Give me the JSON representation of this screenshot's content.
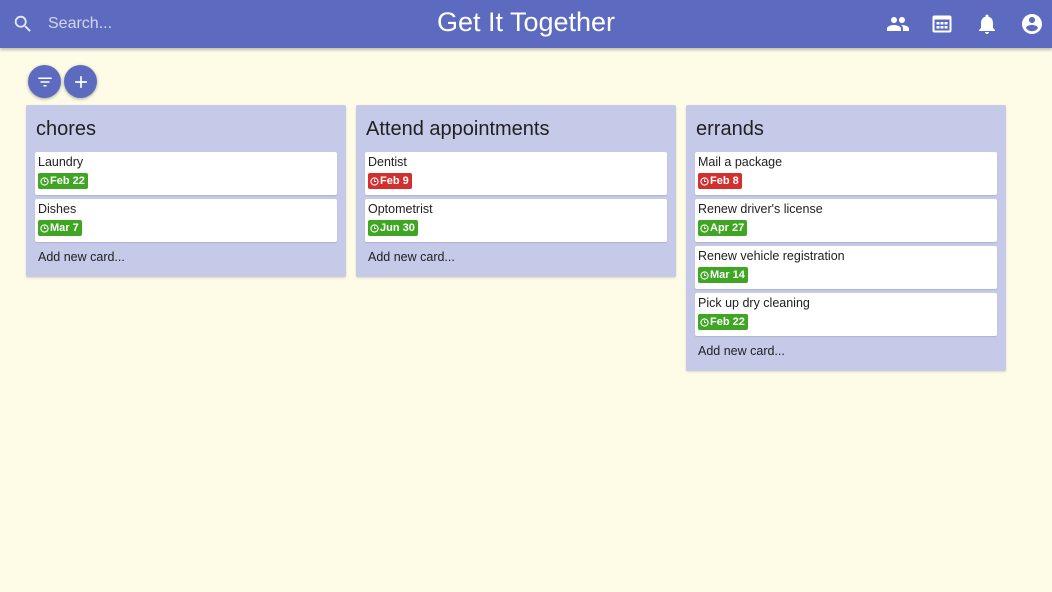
{
  "header": {
    "title": "Get It Together",
    "search_placeholder": "Search...",
    "color": "#5c6bc0"
  },
  "toolbar": {
    "filter_icon": "filter-icon",
    "add_icon": "plus-icon"
  },
  "header_icons": [
    "people-icon",
    "calendar-icon",
    "bell-icon",
    "account-icon"
  ],
  "colors": {
    "background": "#fefce6",
    "list_background": "#c5cae9",
    "badge_green": "#3fa624",
    "badge_red": "#d32f2f"
  },
  "lists": [
    {
      "title": "chores",
      "cards": [
        {
          "title": "Laundry",
          "due": "Feb 22",
          "status": "green"
        },
        {
          "title": "Dishes",
          "due": "Mar 7",
          "status": "green"
        }
      ],
      "add_label": "Add new card..."
    },
    {
      "title": "Attend appointments",
      "cards": [
        {
          "title": "Dentist",
          "due": "Feb 9",
          "status": "red"
        },
        {
          "title": "Optometrist",
          "due": "Jun 30",
          "status": "green"
        }
      ],
      "add_label": "Add new card..."
    },
    {
      "title": "errands",
      "cards": [
        {
          "title": "Mail a package",
          "due": "Feb 8",
          "status": "red"
        },
        {
          "title": "Renew driver's license",
          "due": "Apr 27",
          "status": "green"
        },
        {
          "title": "Renew vehicle registration",
          "due": "Mar 14",
          "status": "green"
        },
        {
          "title": "Pick up dry cleaning",
          "due": "Feb 22",
          "status": "green"
        }
      ],
      "add_label": "Add new card..."
    }
  ]
}
